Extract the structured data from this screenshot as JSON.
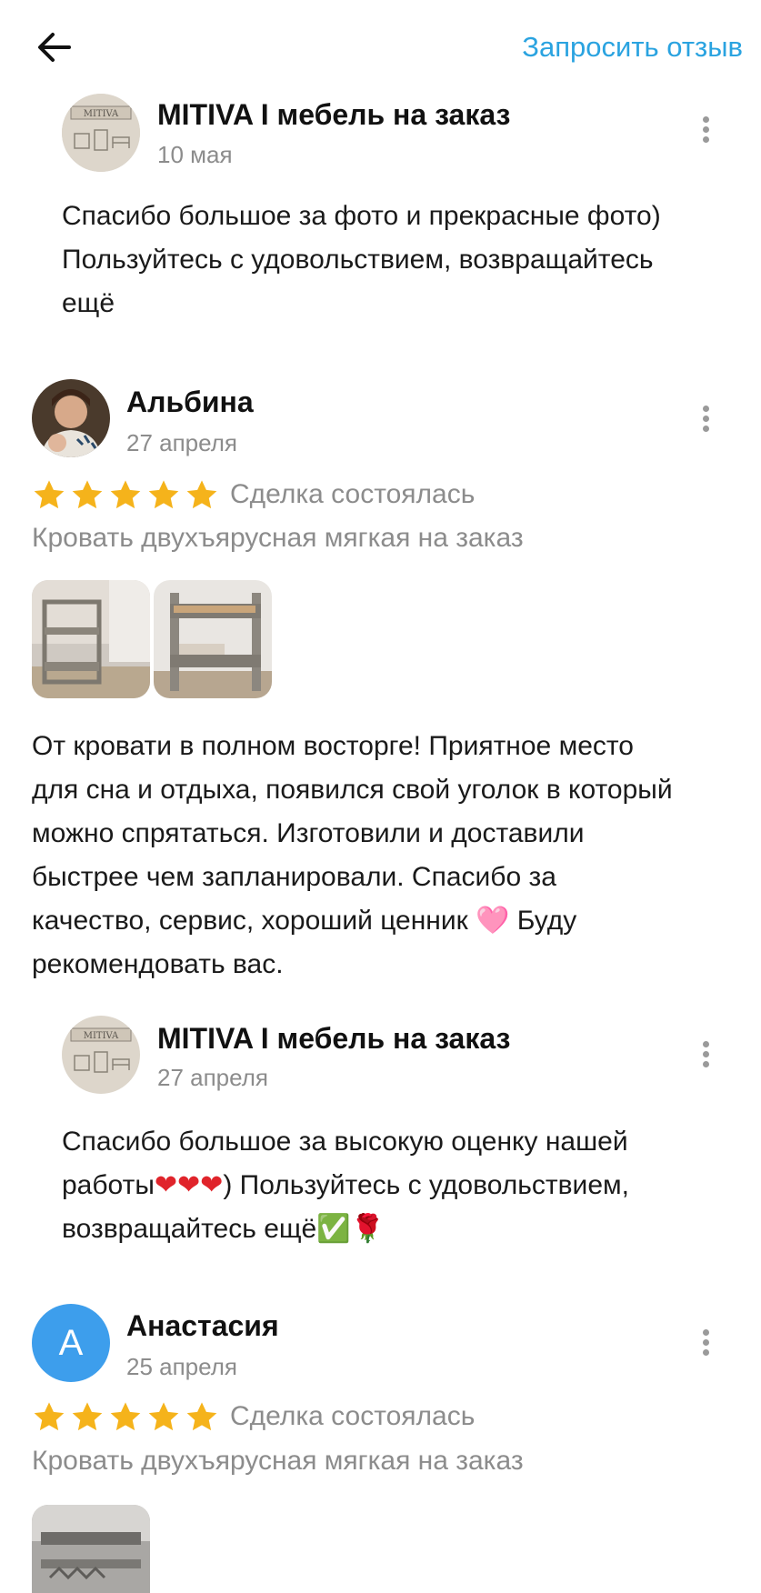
{
  "header": {
    "request_review_label": "Запросить отзыв"
  },
  "reply1": {
    "name": "MITIVA  I  мебель на заказ",
    "date": "10 мая",
    "logo_text": "MITIVA",
    "line1": "Спасибо большое за фото и прекрасные фото)",
    "line2": "Пользуйтесь с удовольствием, возвращайтесь",
    "line3": "ещё"
  },
  "review1": {
    "name": "Альбина",
    "date": "27 апреля",
    "rating": 5,
    "deal_status": "Сделка состоялась",
    "product": "Кровать двухъярусная мягкая на заказ",
    "line1": "От кровати в полном восторге! Приятное место",
    "line2": "для сна и отдыха, появился свой уголок в который",
    "line3": "можно спрятаться. Изготовили и доставили",
    "line4": "быстрее чем запланировали. Спасибо за",
    "line5a": "качество, сервис, хороший ценник ",
    "line5_emoji": "🩷",
    "line5b": " Буду",
    "line6": "рекомендовать вас."
  },
  "reply2": {
    "name": "MITIVA  I  мебель на заказ",
    "date": "27 апреля",
    "logo_text": "MITIVA",
    "line1": "Спасибо большое за высокую оценку нашей",
    "line2a": "работы",
    "line2_emoji": "❤❤❤",
    "line2b": ") Пользуйтесь с удовольствием,",
    "line3a": "возвращайтесь ещё",
    "line3_emoji": "✅🌹"
  },
  "review2": {
    "name": "Анастасия",
    "date": "25 апреля",
    "avatar_letter": "А",
    "rating": 5,
    "deal_status": "Сделка состоялась",
    "product": "Кровать двухъярусная мягкая на заказ"
  },
  "colors": {
    "accent": "#2aa3e0",
    "star": "#f5b31b",
    "avatar_blue": "#3d9eec",
    "muted": "#8c8c8c"
  }
}
